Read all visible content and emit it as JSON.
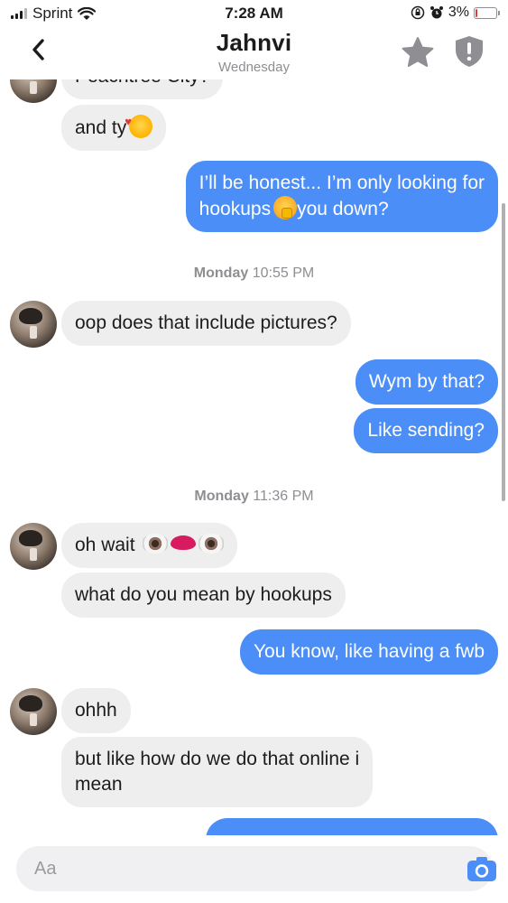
{
  "status_bar": {
    "carrier": "Sprint",
    "time": "7:28 AM",
    "battery_text": "3%",
    "battery_level": 0.03
  },
  "header": {
    "title": "Jahnvi",
    "subtitle": "Wednesday",
    "icons": [
      "chevron-left-icon",
      "star-icon",
      "shield-icon"
    ]
  },
  "messages": {
    "m0": "Peachtree City?",
    "m1": "and ty",
    "m2_line1": "I’ll be honest... I’m only looking for",
    "m2_line2a": "hookups",
    "m2_line2b": "you down?",
    "stamp1_day": "Monday",
    "stamp1_time": "10:55 PM",
    "m3": "oop does that include pictures?",
    "m4": "Wym by that?",
    "m5": "Like sending?",
    "stamp2_day": "Monday",
    "stamp2_time": "11:36 PM",
    "m6": "oh wait",
    "m7": "what do you mean by hookups",
    "m8": "You know, like having a fwb",
    "m9": "ohhh",
    "m10_line1": "but like how do we do that online i",
    "m10_line2": "mean"
  },
  "composer": {
    "placeholder": "Aa",
    "icon": "camera-icon"
  },
  "colors": {
    "outgoing_bubble": "#4c8ef7",
    "incoming_bubble": "#eeeeef",
    "battery_low": "#e53935"
  }
}
